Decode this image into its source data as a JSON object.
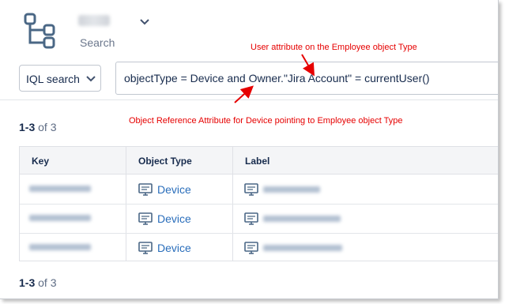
{
  "header": {
    "subtitle": "Search",
    "icons": {
      "schema": "schema-tree-icon",
      "expand": "chevron-down-icon"
    }
  },
  "search": {
    "mode_label": "IQL search",
    "query": "objectType = Device and Owner.\"Jira Account\" = currentUser()"
  },
  "annotations": {
    "top": "User attribute on the Employee object Type",
    "bottom": "Object Reference Attribute for Device pointing to Employee object Type",
    "color": "#e60000"
  },
  "results": {
    "count_top": {
      "range": "1-3",
      "of": "of 3"
    },
    "count_bottom": {
      "range": "1-3",
      "of": "of 3"
    },
    "columns": [
      "Key",
      "Object Type",
      "Label"
    ],
    "rows": [
      {
        "object_type": "Device"
      },
      {
        "object_type": "Device"
      },
      {
        "object_type": "Device"
      }
    ]
  },
  "colors": {
    "link": "#2a6ebb",
    "accent_icon": "#4a6785",
    "annotation": "#e60000"
  }
}
